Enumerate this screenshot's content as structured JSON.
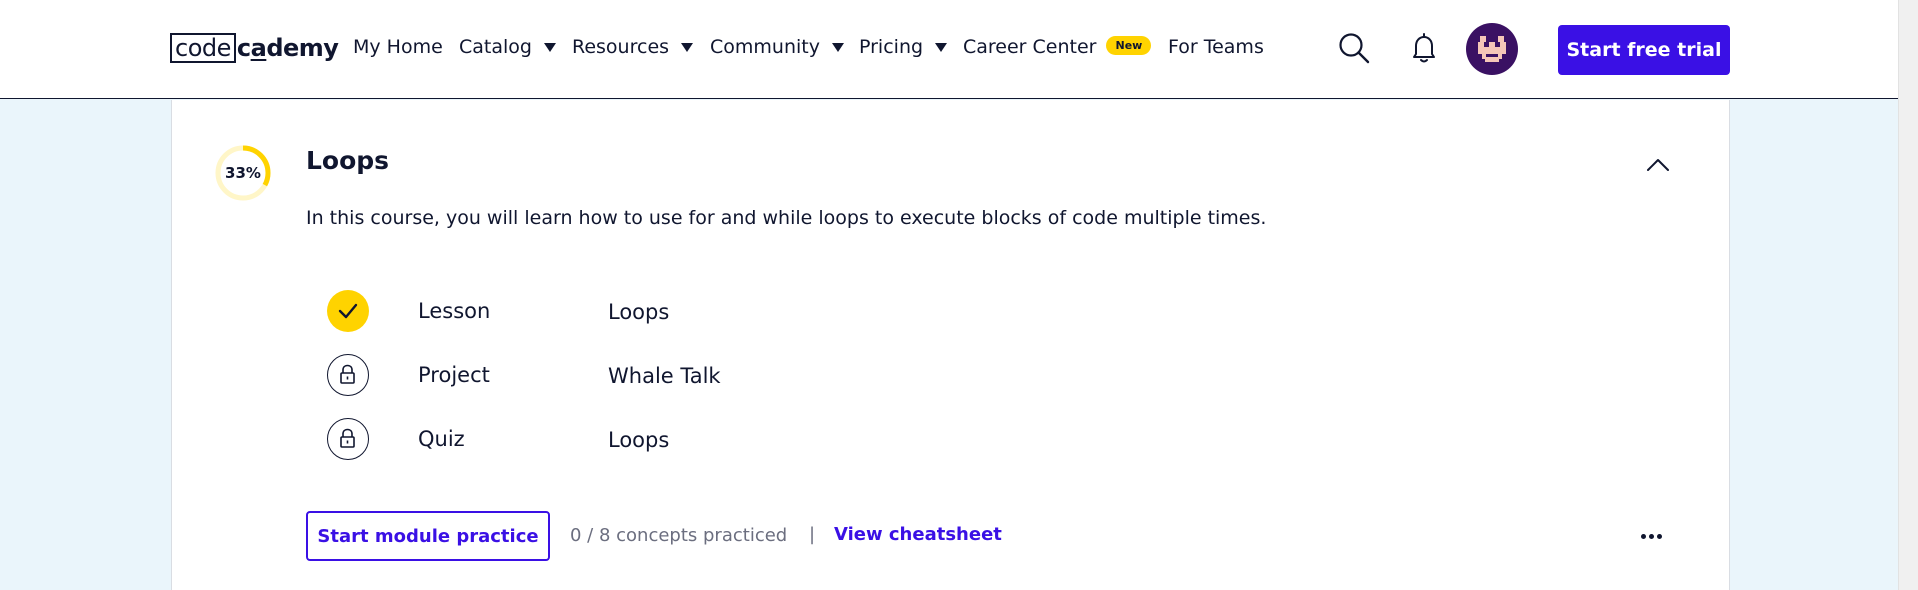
{
  "header": {
    "logo": {
      "boxed": "code",
      "rest_pre": "c",
      "rest_underlined": "a",
      "rest_post": "demy"
    },
    "nav": [
      {
        "label": "My Home",
        "has_caret": false
      },
      {
        "label": "Catalog",
        "has_caret": true
      },
      {
        "label": "Resources",
        "has_caret": true
      },
      {
        "label": "Community",
        "has_caret": true
      },
      {
        "label": "Pricing",
        "has_caret": true
      },
      {
        "label": "Career Center",
        "has_caret": false,
        "badge": "New"
      },
      {
        "label": "For Teams",
        "has_caret": false
      }
    ],
    "icons": [
      "search-icon",
      "bell-icon"
    ],
    "cta": "Start free trial"
  },
  "module": {
    "progress_label": "33%",
    "progress_fraction": 0.33,
    "title": "Loops",
    "description": "In this course, you will learn how to use for and while loops to execute blocks of code multiple times.",
    "items": [
      {
        "kind": "Lesson",
        "name": "Loops",
        "status": "completed"
      },
      {
        "kind": "Project",
        "name": "Whale Talk",
        "status": "locked"
      },
      {
        "kind": "Quiz",
        "name": "Loops",
        "status": "locked"
      }
    ],
    "practice_button": "Start module practice",
    "practiced_text": "0 / 8 concepts practiced",
    "separator": "|",
    "cheatsheet_link": "View cheatsheet"
  },
  "colors": {
    "brand": "#3a10e5",
    "accent_yellow": "#ffd300",
    "navy": "#10162f",
    "page_bg": "#eaf5fb"
  }
}
